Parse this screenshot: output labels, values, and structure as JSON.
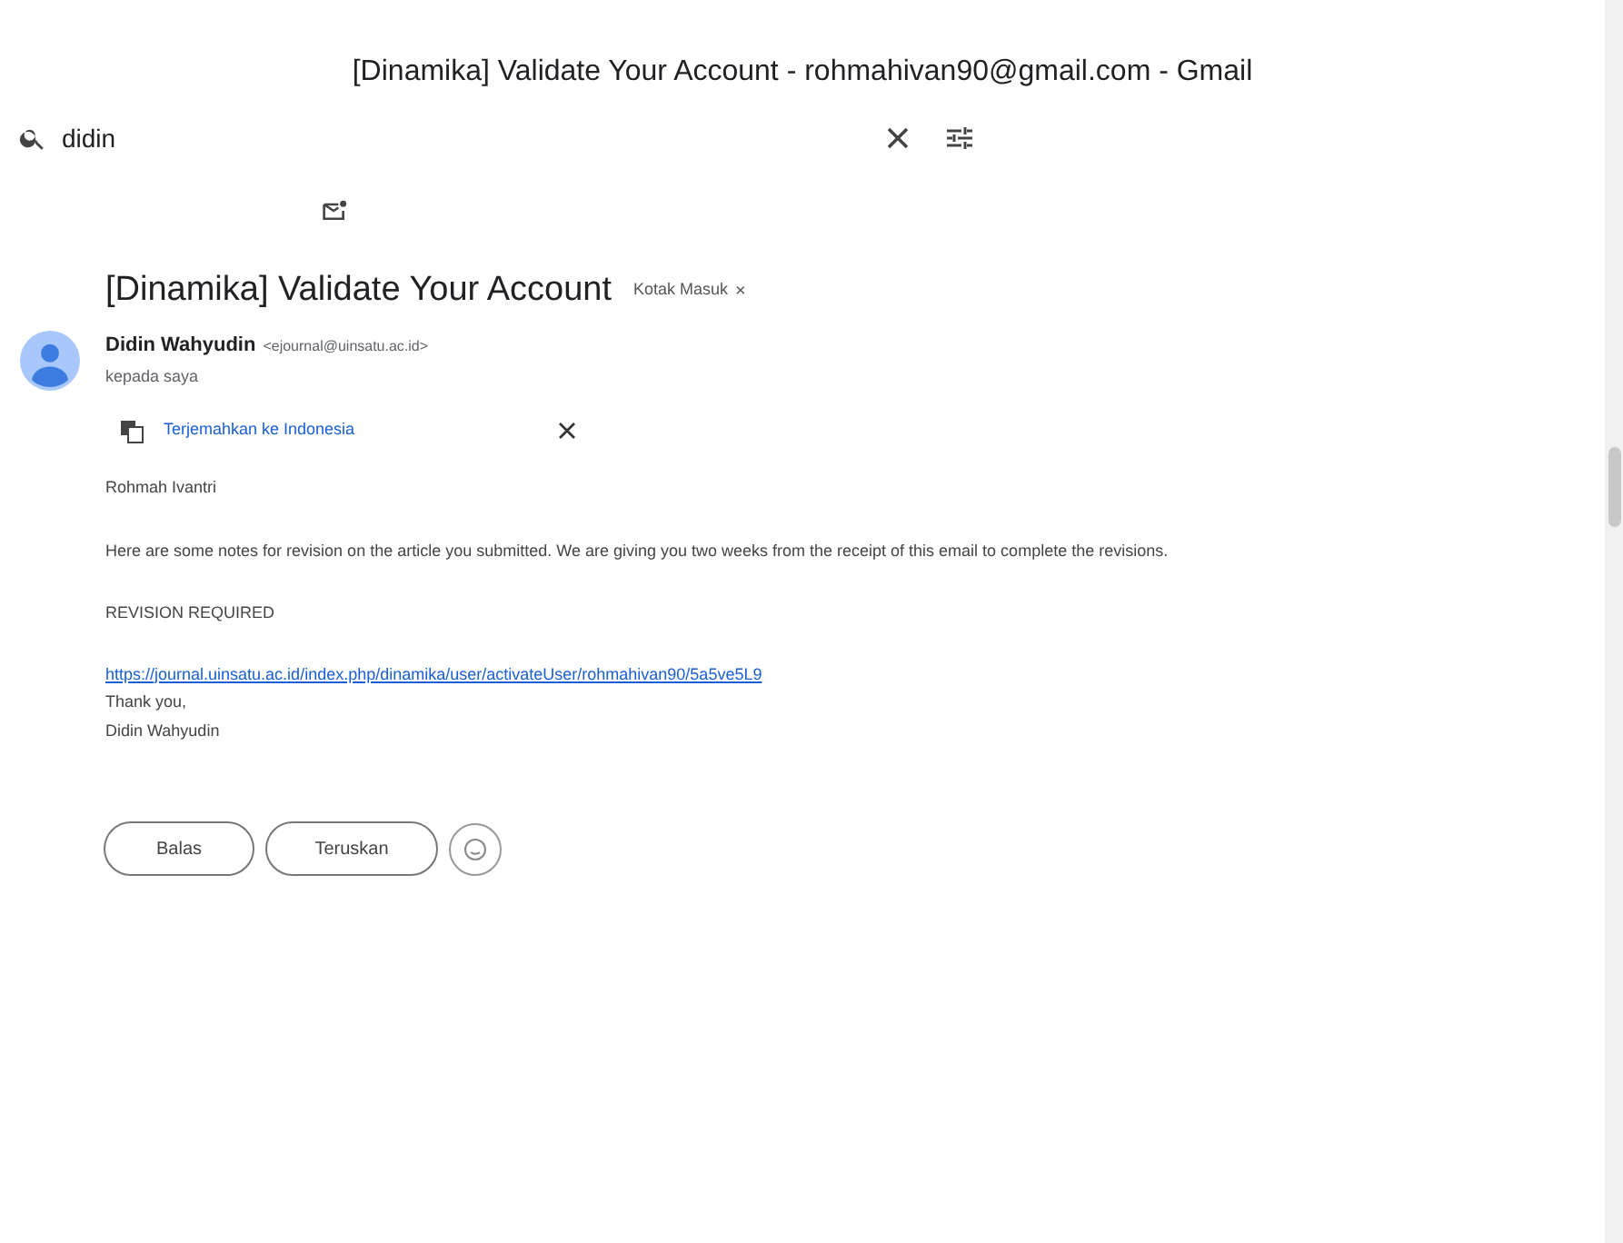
{
  "window": {
    "title": "[Dinamika] Validate Your Account - rohmahivan90@gmail.com - Gmail"
  },
  "search": {
    "value": "didin"
  },
  "message": {
    "subject": "[Dinamika] Validate Your Account",
    "label": "Kotak Masuk",
    "label_close": "×",
    "sender": {
      "name": "Didin Wahyudin",
      "email": "<ejournal@uinsatu.ac.id>",
      "to": "kepada saya"
    },
    "translate": "Terjemahkan ke Indonesia",
    "body": {
      "greeting": "Rohmah Ivantri",
      "paragraph": "Here are some notes for revision on the article you submitted. We are giving you two weeks from the receipt of this email to complete the revisions.",
      "notice": "REVISION REQUIRED",
      "link": "https://journal.uinsatu.ac.id/index.php/dinamika/user/activateUser/rohmahivan90/5a5ve5L9",
      "closing": "Thank you,",
      "signature": "Didin Wahyudin"
    }
  },
  "actions": [
    "Balas",
    "Teruskan"
  ]
}
